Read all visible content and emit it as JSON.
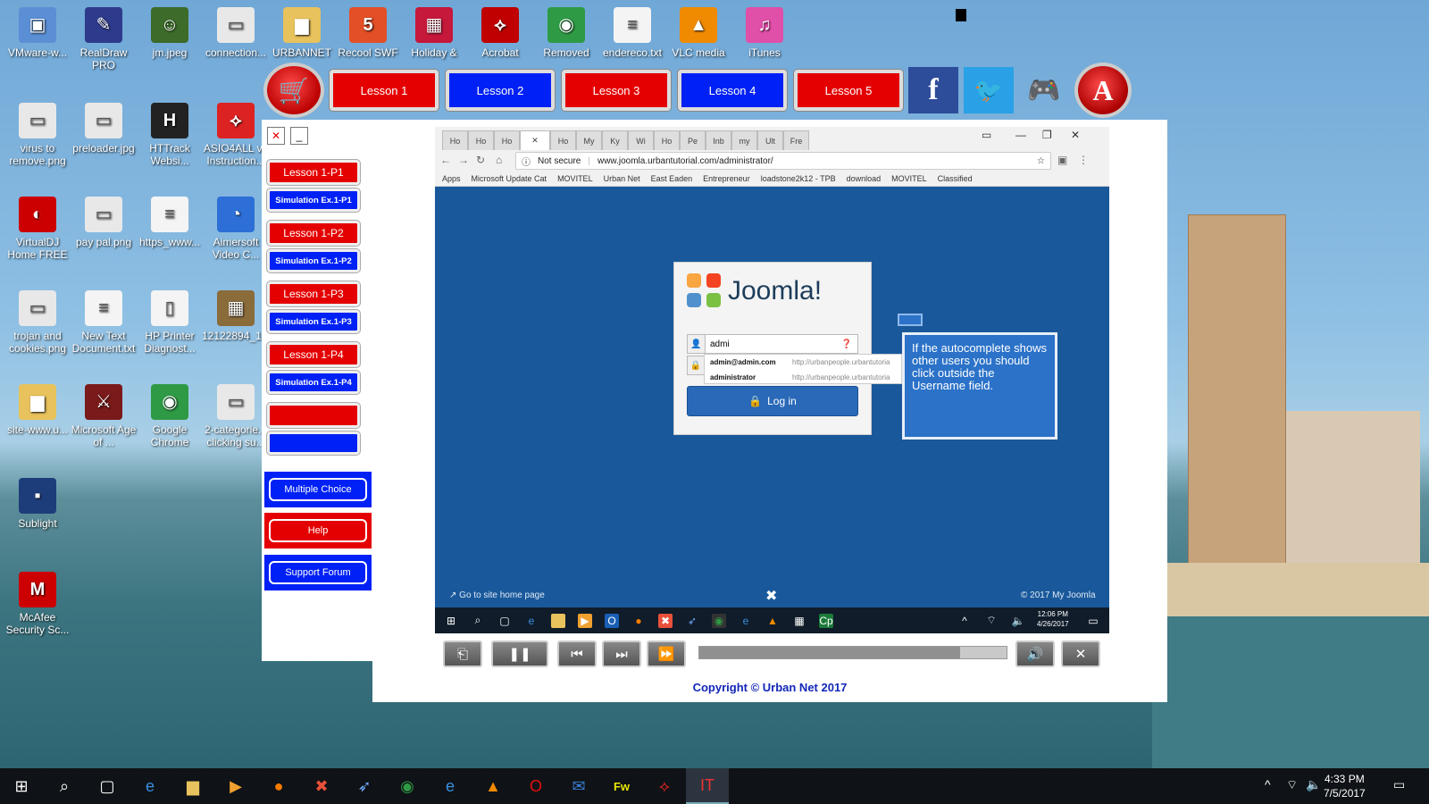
{
  "desktop_icons": [
    {
      "label": "VMware-w...",
      "icon": "vmware-icon",
      "glyph": "▣",
      "color": "#5a8fd6"
    },
    {
      "label": "RealDraw PRO",
      "icon": "realdraw-icon",
      "glyph": "✎",
      "color": "#2e3a8c"
    },
    {
      "label": "jm.jpeg",
      "icon": "image-file-icon",
      "glyph": "☺",
      "color": "#3c6b2a"
    },
    {
      "label": "connection...",
      "icon": "image-file-icon",
      "glyph": "▭",
      "color": "#e8e8e8"
    },
    {
      "label": "URBANNET",
      "icon": "folder-icon",
      "glyph": "▆",
      "color": "#e8c25c"
    },
    {
      "label": "Recool SWF",
      "icon": "html5-icon",
      "glyph": "5",
      "color": "#e34f26"
    },
    {
      "label": "Holiday &",
      "icon": "holiday-icon",
      "glyph": "▦",
      "color": "#c5183a"
    },
    {
      "label": "Acrobat",
      "icon": "acrobat-icon",
      "glyph": "⟡",
      "color": "#c00000"
    },
    {
      "label": "Removed",
      "icon": "chrome-icon",
      "glyph": "◉",
      "color": "#2f9a45"
    },
    {
      "label": "endereco.txt",
      "icon": "text-file-icon",
      "glyph": "≡",
      "color": "#f4f4f4"
    },
    {
      "label": "VLC media",
      "icon": "vlc-icon",
      "glyph": "▲",
      "color": "#f08a00"
    },
    {
      "label": "iTunes",
      "icon": "itunes-icon",
      "glyph": "♫",
      "color": "#e04fa8"
    },
    {
      "label": "virus to remove.png",
      "icon": "image-file-icon",
      "glyph": "▭",
      "color": "#e8e8e8"
    },
    {
      "label": "preloader.jpg",
      "icon": "image-file-icon",
      "glyph": "▭",
      "color": "#e8e8e8"
    },
    {
      "label": "HTTrack Websi...",
      "icon": "httrack-icon",
      "glyph": "H",
      "color": "#222"
    },
    {
      "label": "ASIO4ALL v2 Instruction...",
      "icon": "pdf-icon",
      "glyph": "⟡",
      "color": "#d22"
    },
    {
      "label": "VirtualDJ Home FREE",
      "icon": "virtualdj-icon",
      "glyph": "◐",
      "color": "#c00"
    },
    {
      "label": "pay pal.png",
      "icon": "image-file-icon",
      "glyph": "▭",
      "color": "#e8e8e8"
    },
    {
      "label": "https_www...",
      "icon": "text-file-icon",
      "glyph": "≡",
      "color": "#f4f4f4"
    },
    {
      "label": "Aimersoft Video C...",
      "icon": "aimersoft-icon",
      "glyph": "◔",
      "color": "#2d6fd6"
    },
    {
      "label": "trojan and cookies.png",
      "icon": "image-file-icon",
      "glyph": "▭",
      "color": "#e8e8e8"
    },
    {
      "label": "New Text Document.txt",
      "icon": "text-file-icon",
      "glyph": "≡",
      "color": "#f4f4f4"
    },
    {
      "label": "HP Printer Diagnost...",
      "icon": "file-icon",
      "glyph": "▯",
      "color": "#f4f4f4"
    },
    {
      "label": "12122894_1...",
      "icon": "image-file-icon",
      "glyph": "▦",
      "color": "#8a6b3a"
    },
    {
      "label": "site-www.u...",
      "icon": "zip-folder-icon",
      "glyph": "▆",
      "color": "#e8c25c"
    },
    {
      "label": "Microsoft Age of ...",
      "icon": "aoe-icon",
      "glyph": "⚔",
      "color": "#7a1a1a"
    },
    {
      "label": "Google Chrome",
      "icon": "chrome-icon",
      "glyph": "◉",
      "color": "#2f9a45"
    },
    {
      "label": "2-categorie... clicking su...",
      "icon": "image-file-icon",
      "glyph": "▭",
      "color": "#e8e8e8"
    },
    {
      "label": "Sublight",
      "icon": "sublight-icon",
      "glyph": "▪",
      "color": "#1d3d7a"
    },
    {
      "label": "McAfee Security Sc...",
      "icon": "mcafee-icon",
      "glyph": "M",
      "color": "#c00"
    }
  ],
  "top_tabs": [
    {
      "label": "Lesson 1",
      "color": "red"
    },
    {
      "label": "Lesson 2",
      "color": "blue"
    },
    {
      "label": "Lesson 3",
      "color": "red"
    },
    {
      "label": "Lesson 4",
      "color": "blue"
    },
    {
      "label": "Lesson 5",
      "color": "red"
    }
  ],
  "side_buttons": [
    {
      "label": "Lesson 1-P1",
      "color": "red"
    },
    {
      "label": "Simulation Ex.1-P1",
      "color": "blue"
    },
    {
      "label": "Lesson 1-P2",
      "color": "red"
    },
    {
      "label": "Simulation Ex.1-P2",
      "color": "blue"
    },
    {
      "label": "Lesson 1-P3",
      "color": "red"
    },
    {
      "label": "Simulation Ex.1-P3",
      "color": "blue"
    },
    {
      "label": "Lesson 1-P4",
      "color": "red"
    },
    {
      "label": "Simulation Ex.1-P4",
      "color": "blue"
    },
    {
      "label": "",
      "color": "red"
    },
    {
      "label": "",
      "color": "blue"
    }
  ],
  "panel_buttons": [
    {
      "label": "Multiple Choice",
      "bg": "#0021f5"
    },
    {
      "label": "Help",
      "bg": "#e40000"
    },
    {
      "label": "Support Forum",
      "bg": "#0021f5"
    }
  ],
  "browser": {
    "tabs": [
      "Ho",
      "Ho",
      "Ho",
      "✕",
      "Ho",
      "My",
      "Ky",
      "Wi",
      "Ho",
      "Pe",
      "Inb",
      "my",
      "Ult",
      "Fre"
    ],
    "security": "Not secure",
    "url": "www.joomla.urbantutorial.com/administrator/",
    "bookmarks": [
      "Apps",
      "Microsoft Update Cat",
      "MOVITEL",
      "Urban Net",
      "East Eaden",
      "Entrepreneur",
      "loadstone2k12 - TPB",
      "download",
      "MOVITEL",
      "Classified"
    ]
  },
  "login": {
    "logo_text": "Joomla!",
    "username_value": "admi",
    "button": "Log in",
    "suggestions": [
      {
        "user": "admin@admin.com",
        "site": "http://urbanpeople.urbantutoria"
      },
      {
        "user": "administrator",
        "site": "http://urbanpeople.urbantutoria"
      }
    ]
  },
  "callout": "If the autocomplete shows other users you should click outside the Username field.",
  "site_footer": {
    "left": "Go to site home page",
    "right": "© 2017 My Joomla"
  },
  "inner_clock": {
    "time": "12:06 PM",
    "date": "4/26/2017"
  },
  "player": {
    "progress": 0.85
  },
  "copyright": "Copyright © Urban Net 2017",
  "clock": {
    "time": "4:33 PM",
    "date": "7/5/2017"
  }
}
